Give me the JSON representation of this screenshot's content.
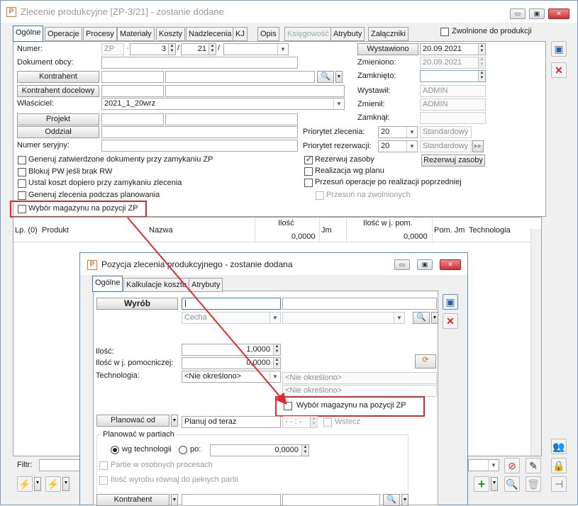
{
  "main": {
    "title": "Zlecenie produkcyjne  [ZP-3/21]  - zostanie dodane",
    "logo": "P",
    "controls": {
      "minimize": "▭",
      "restore": "▣",
      "close": "✕"
    },
    "tabs": [
      "Ogólne",
      "Operacje",
      "Procesy",
      "Materiały",
      "Koszty",
      "Nadzlecenia",
      "KJ",
      "Opis",
      "Księgowość",
      "Atrybuty",
      "Załączniki"
    ],
    "zwolnione": "Zwolnione do produkcji",
    "numer_label": "Numer:",
    "numer_prefix": "ZP",
    "numer_value": "3",
    "numer_year": "21",
    "dokument_obcy": "Dokument obcy:",
    "kontrahent": "Kontrahent",
    "kontrahent_docelowy": "Kontrahent docelowy",
    "wlasciciel_label": "Właściciel:",
    "wlasciciel_value": "2021_1_20wrz",
    "projekt": "Projekt",
    "oddzial": "Oddział",
    "numer_seryjny": "Numer seryjny:",
    "wystawiono_btn": "Wystawiono",
    "wystawiono_value": "20.09.2021",
    "zmieniono_label": "Zmieniono:",
    "zmieniono_value": "20.09.2021",
    "zamknieto_label": "Zamknięto:",
    "wystawil_label": "Wystawił:",
    "wystawil_value": "ADMIN",
    "zmienil_label": "Zmienił:",
    "zmienil_value": "ADMIN",
    "zamknal_label": "Zamknął:",
    "priorytet_zlecenia_label": "Priorytet zlecenia:",
    "priorytet_zlecenia_value": "20",
    "priorytet_rezerwacji_label": "Priorytet rezerwacji:",
    "priorytet_rezerwacji_value": "20",
    "standardowy": "Standardowy",
    "rezerwuj_btn": "Rezerwuj zasoby",
    "checks_left": [
      "Generuj zatwierdzone dokumenty przy zamykaniu ZP",
      "Blokuj PW jeśli brak RW",
      "Ustal koszt dopiero przy zamykaniu zlecenia",
      "Generuj zlecenia podczas planowania",
      "Wybór magazynu na pozycji ZP"
    ],
    "checks_right": [
      "Rezerwuj zasoby",
      "Realizacja wg planu",
      "Przesuń operacje po realizacji poprzedniej",
      "Przesuń na zwolnionych"
    ],
    "table": {
      "lp": "Lp. (0)",
      "produkt": "Produkt",
      "nazwa": "Nazwa",
      "ilosc": "Ilość",
      "ilosc_sum": "0,0000",
      "jm": "Jm",
      "ilosc_jpom": "Ilość w j. pom.",
      "ilosc_jpom_sum": "0,0000",
      "pom_jm": "Pom. Jm",
      "technologia": "Technologia"
    },
    "filtr_label": "Filtr:"
  },
  "dialog": {
    "title": "Pozycja zlecenia produkcyjnego - zostanie dodana",
    "logo": "P",
    "tabs": [
      "Ogólne",
      "Kalkulacje kosztu",
      "Atrybuty"
    ],
    "wyrob_btn": "Wyrób",
    "cecha": "Cecha",
    "ilosc_label": "Ilość:",
    "ilosc_value": "1,0000",
    "ilosc_pom_label": "Ilość w j. pomocniczej:",
    "ilosc_pom_value": "0,0000",
    "technologia_label": "Technologia:",
    "technologia_value": "<Nie określono>",
    "nie_okreslono_1": "<Nie określono>",
    "nie_okreslono_2": "<Nie określono>",
    "wybor_magazynu": "Wybór magazynu na pozycji ZP",
    "planowac_od_btn": "Planować od",
    "planuj_od_teraz": "Planuj od teraz",
    "time_value": "- - : -",
    "wstecz": "Wstecz",
    "partie_group": "Planować w partiach",
    "wg_technologii": "wg technologii",
    "po_label": "po:",
    "po_value": "0,0000",
    "partie_osobnych": "Partie w osobnych procesach",
    "ilosc_pelnych": "Ilość wyrobu równaj do pełnych partii",
    "kontrahent_btn": "Kontrahent"
  }
}
